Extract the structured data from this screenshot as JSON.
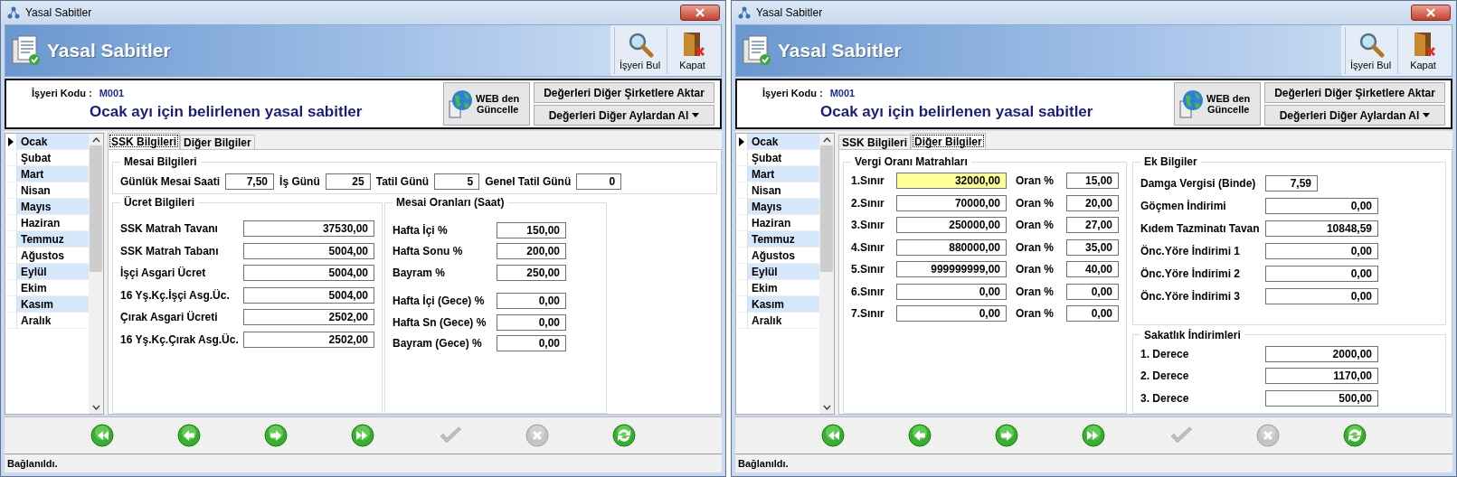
{
  "windows": [
    {
      "title": "Yasal Sabitler",
      "header_title": "Yasal Sabitler",
      "toolbar": [
        {
          "kind": "find",
          "label": "İşyeri Bul"
        },
        {
          "kind": "close",
          "label": "Kapat"
        }
      ],
      "company_label": "İşyeri Kodu :",
      "company_code": "M001",
      "subtitle": "Ocak ayı için belirlenen yasal sabitler",
      "web_button": "WEB den\nGüncelle",
      "action_buttons": [
        {
          "label": "Değerleri Diğer Şirketlere Aktar",
          "dropdown": false
        },
        {
          "label": "Değerleri Diğer Aylardan Al",
          "dropdown": true
        }
      ],
      "months": [
        {
          "label": "Ocak",
          "selected": true
        },
        {
          "label": "Şubat",
          "selected": false
        },
        {
          "label": "Mart",
          "selected": false
        },
        {
          "label": "Nisan",
          "selected": false
        },
        {
          "label": "Mayıs",
          "selected": false
        },
        {
          "label": "Haziran",
          "selected": false
        },
        {
          "label": "Temmuz",
          "selected": false
        },
        {
          "label": "Ağustos",
          "selected": false
        },
        {
          "label": "Eylül",
          "selected": false
        },
        {
          "label": "Ekim",
          "selected": false
        },
        {
          "label": "Kasım",
          "selected": false
        },
        {
          "label": "Aralık",
          "selected": false
        }
      ],
      "tabs": [
        {
          "label": "SSK Bilgileri",
          "selected": true
        },
        {
          "label": "Diğer Bilgiler",
          "selected": false
        }
      ],
      "page": {
        "kind": "ssk",
        "shift": {
          "title": "Mesai Bilgileri",
          "fields": [
            {
              "label": "Günlük Mesai Saati",
              "value": "7,50"
            },
            {
              "label": "İş Günü",
              "value": "25"
            },
            {
              "label": "Tatil Günü",
              "value": "5"
            },
            {
              "label": "Genel Tatil Günü",
              "value": "0"
            }
          ]
        },
        "wages": {
          "title": "Ücret Bilgileri",
          "fields": [
            {
              "label": "SSK Matrah Tavanı",
              "value": "37530,00"
            },
            {
              "label": "SSK Matrah Tabanı",
              "value": "5004,00"
            },
            {
              "label": "İşçi Asgari Ücret",
              "value": "5004,00"
            },
            {
              "label": "16 Yş.Kç.İşçi Asg.Üc.",
              "value": "5004,00"
            },
            {
              "label": "Çırak Asgari Ücreti",
              "value": "2502,00"
            },
            {
              "label": "16 Yş.Kç.Çırak Asg.Üc.",
              "value": "2502,00"
            }
          ]
        },
        "rates": {
          "title": "Mesai Oranları (Saat)",
          "sections": [
            {
              "fields": [
                {
                  "label": "Hafta İçi %",
                  "value": "150,00"
                },
                {
                  "label": "Hafta Sonu %",
                  "value": "200,00"
                },
                {
                  "label": "Bayram %",
                  "value": "250,00"
                }
              ]
            },
            {
              "fields": [
                {
                  "label": "Hafta İçi (Gece) %",
                  "value": "0,00"
                },
                {
                  "label": "Hafta Sn (Gece) %",
                  "value": "0,00"
                },
                {
                  "label": "Bayram (Gece) %",
                  "value": "0,00"
                }
              ]
            }
          ]
        }
      },
      "nav": [
        {
          "kind": "first",
          "disabled": false
        },
        {
          "kind": "prev",
          "disabled": false
        },
        {
          "kind": "next",
          "disabled": false
        },
        {
          "kind": "last",
          "disabled": false
        },
        {
          "kind": "save",
          "disabled": true
        },
        {
          "kind": "cancel",
          "disabled": true
        },
        {
          "kind": "refresh",
          "disabled": false
        }
      ],
      "status": "Bağlanıldı."
    },
    {
      "title": "Yasal Sabitler",
      "header_title": "Yasal Sabitler",
      "toolbar": [
        {
          "kind": "find",
          "label": "İşyeri Bul"
        },
        {
          "kind": "close",
          "label": "Kapat"
        }
      ],
      "company_label": "İşyeri Kodu :",
      "company_code": "M001",
      "subtitle": "Ocak ayı için belirlenen yasal sabitler",
      "web_button": "WEB den\nGüncelle",
      "action_buttons": [
        {
          "label": "Değerleri Diğer Şirketlere Aktar",
          "dropdown": false
        },
        {
          "label": "Değerleri Diğer Aylardan Al",
          "dropdown": true
        }
      ],
      "months": [
        {
          "label": "Ocak",
          "selected": true
        },
        {
          "label": "Şubat",
          "selected": false
        },
        {
          "label": "Mart",
          "selected": false
        },
        {
          "label": "Nisan",
          "selected": false
        },
        {
          "label": "Mayıs",
          "selected": false
        },
        {
          "label": "Haziran",
          "selected": false
        },
        {
          "label": "Temmuz",
          "selected": false
        },
        {
          "label": "Ağustos",
          "selected": false
        },
        {
          "label": "Eylül",
          "selected": false
        },
        {
          "label": "Ekim",
          "selected": false
        },
        {
          "label": "Kasım",
          "selected": false
        },
        {
          "label": "Aralık",
          "selected": false
        }
      ],
      "tabs": [
        {
          "label": "SSK Bilgileri",
          "selected": false
        },
        {
          "label": "Diğer Bilgiler",
          "selected": true
        }
      ],
      "page": {
        "kind": "other",
        "brackets": {
          "title": "Vergi Oranı Matrahları",
          "rows": [
            {
              "label": "1.Sınır",
              "value": "32000,00",
              "rate_label": "Oran %",
              "rate": "15,00",
              "focused": true
            },
            {
              "label": "2.Sınır",
              "value": "70000,00",
              "rate_label": "Oran %",
              "rate": "20,00",
              "focused": false
            },
            {
              "label": "3.Sınır",
              "value": "250000,00",
              "rate_label": "Oran %",
              "rate": "27,00",
              "focused": false
            },
            {
              "label": "4.Sınır",
              "value": "880000,00",
              "rate_label": "Oran %",
              "rate": "35,00",
              "focused": false
            },
            {
              "label": "5.Sınır",
              "value": "999999999,00",
              "rate_label": "Oran %",
              "rate": "40,00",
              "focused": false
            },
            {
              "label": "6.Sınır",
              "value": "0,00",
              "rate_label": "Oran %",
              "rate": "0,00",
              "focused": false
            },
            {
              "label": "7.Sınır",
              "value": "0,00",
              "rate_label": "Oran %",
              "rate": "0,00",
              "focused": false
            }
          ]
        },
        "extra": {
          "title": "Ek Bilgiler",
          "fields": [
            {
              "label": "Damga Vergisi (Binde)",
              "value": "7,59",
              "kind": "short"
            },
            {
              "label": "Göçmen İndirimi",
              "value": "0,00",
              "kind": "long"
            },
            {
              "label": "Kıdem Tazminatı Tavan",
              "value": "10848,59",
              "kind": "long"
            },
            {
              "label": "Önc.Yöre İndirimi 1",
              "value": "0,00",
              "kind": "long"
            },
            {
              "label": "Önc.Yöre İndirimi 2",
              "value": "0,00",
              "kind": "long"
            },
            {
              "label": "Önc.Yöre İndirimi 3",
              "value": "0,00",
              "kind": "long"
            }
          ]
        },
        "disability": {
          "title": "Sakatlık İndirimleri",
          "fields": [
            {
              "label": "1. Derece",
              "value": "2000,00"
            },
            {
              "label": "2. Derece",
              "value": "1170,00"
            },
            {
              "label": "3. Derece",
              "value": "500,00"
            }
          ]
        }
      },
      "nav": [
        {
          "kind": "first",
          "disabled": false
        },
        {
          "kind": "prev",
          "disabled": false
        },
        {
          "kind": "next",
          "disabled": false
        },
        {
          "kind": "last",
          "disabled": false
        },
        {
          "kind": "save",
          "disabled": true
        },
        {
          "kind": "cancel",
          "disabled": true
        },
        {
          "kind": "refresh",
          "disabled": false
        }
      ],
      "status": "Bağlanıldı."
    }
  ]
}
